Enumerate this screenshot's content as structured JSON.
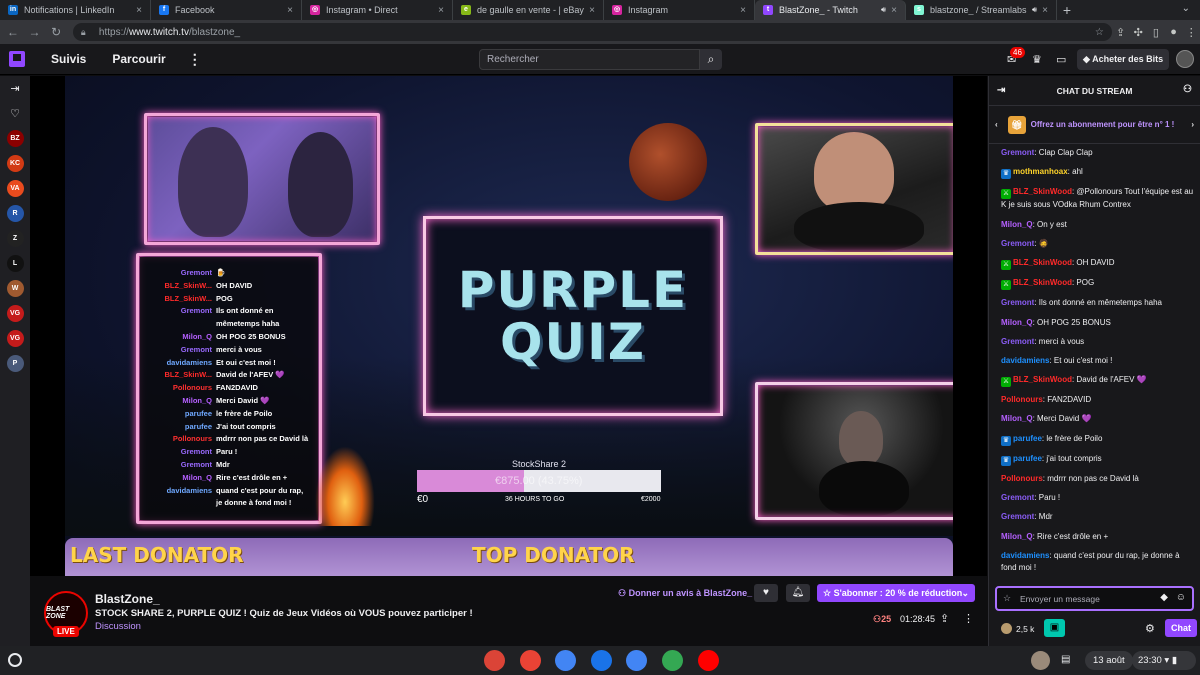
{
  "browser": {
    "tabs": [
      {
        "title": "Notifications | LinkedIn",
        "icon": "in",
        "color": "#0a66c2",
        "active": false,
        "audio": false
      },
      {
        "title": "Facebook",
        "icon": "f",
        "color": "#1877f2",
        "active": false,
        "audio": false
      },
      {
        "title": "Instagram • Direct",
        "icon": "◎",
        "color": "#d6249f",
        "active": false,
        "audio": false
      },
      {
        "title": "de gaulle en vente - | eBay",
        "icon": "e",
        "color": "#86b817",
        "active": false,
        "audio": false
      },
      {
        "title": "Instagram",
        "icon": "◎",
        "color": "#d6249f",
        "active": false,
        "audio": false
      },
      {
        "title": "BlastZone_ - Twitch",
        "icon": "t",
        "color": "#9147ff",
        "active": true,
        "audio": true
      },
      {
        "title": "blastzone_ / Streamlabs",
        "icon": "s",
        "color": "#80f5d2",
        "active": false,
        "audio": true
      }
    ],
    "url_scheme": "https://",
    "url_host": "www.twitch.tv",
    "url_path": "/blastzone_"
  },
  "twitch_nav": {
    "following": "Suivis",
    "browse": "Parcourir",
    "search_placeholder": "Rechercher",
    "notifications_count": "46",
    "get_bits": "Acheter des Bits"
  },
  "sidebar_channels": [
    {
      "initials": "BZ",
      "color": "#8b0000"
    },
    {
      "initials": "KC",
      "color": "#d23a14"
    },
    {
      "initials": "VA",
      "color": "#e94b1e"
    },
    {
      "initials": "R",
      "color": "#2556a8"
    },
    {
      "initials": "Z",
      "color": "#222"
    },
    {
      "initials": "L",
      "color": "#111"
    },
    {
      "initials": "W",
      "color": "#a05a30"
    },
    {
      "initials": "VG",
      "color": "#c41b1b"
    },
    {
      "initials": "VG",
      "color": "#c41b1b"
    },
    {
      "initials": "P",
      "color": "#4a5a7a"
    }
  ],
  "stream": {
    "quiz_line1": "PURPLE",
    "quiz_line2": "QUIZ",
    "goal_title": "StockShare 2",
    "goal_value": "€875.00 (43.75%)",
    "goal_progress": 0.4375,
    "goal_min": "€0",
    "goal_countdown": "36 HOURS TO GO",
    "goal_max": "€2000",
    "last_donator": "LAST DONATOR",
    "top_donator": "TOP DONATOR",
    "overlay_chat": [
      {
        "user": "Gremont",
        "color": "#9a6aff",
        "text": "🍺"
      },
      {
        "user": "BLZ_SkinW...",
        "color": "#ff2a2a",
        "text": "OH DAVID"
      },
      {
        "user": "BLZ_SkinW...",
        "color": "#ff2a2a",
        "text": "POG"
      },
      {
        "user": "Gremont",
        "color": "#9a6aff",
        "text": "Ils ont donné en\nmêmetemps haha"
      },
      {
        "user": "Milon_Q",
        "color": "#b560ff",
        "text": "OH POG 25 BONUS"
      },
      {
        "user": "Gremont",
        "color": "#9a6aff",
        "text": "merci à vous"
      },
      {
        "user": "davidamiens",
        "color": "#6fa8ff",
        "text": "Et oui c'est moi !"
      },
      {
        "user": "BLZ_SkinW...",
        "color": "#ff2a2a",
        "text": "David de l'AFEV 💜"
      },
      {
        "user": "Pollonours",
        "color": "#ff3030",
        "text": "FAN2DAVID"
      },
      {
        "user": "Milon_Q",
        "color": "#b560ff",
        "text": "Merci David 💜"
      },
      {
        "user": "parufee",
        "color": "#6fa8ff",
        "text": "le frère de Poilo"
      },
      {
        "user": "parufee",
        "color": "#6fa8ff",
        "text": "J'ai tout compris"
      },
      {
        "user": "Pollonours",
        "color": "#ff3030",
        "text": "mdrrr non pas ce David là"
      },
      {
        "user": "Gremont",
        "color": "#9a6aff",
        "text": "Paru !"
      },
      {
        "user": "Gremont",
        "color": "#9a6aff",
        "text": "Mdr"
      },
      {
        "user": "Milon_Q",
        "color": "#b560ff",
        "text": "Rire c'est drôle en +"
      },
      {
        "user": "davidamiens",
        "color": "#6fa8ff",
        "text": "quand c'est pour du rap,\nje donne à fond moi !"
      }
    ]
  },
  "channel": {
    "logo_text": "BLAST ZONE",
    "live": "LIVE",
    "name": "BlastZone_",
    "title": "STOCK SHARE 2, PURPLE QUIZ ! Quiz de Jeux Vidéos où VOUS pouvez participer !",
    "category": "Discussion",
    "review": "Donner un avis à BlastZone_",
    "subscribe": "S'abonner : 20 % de réduction",
    "viewers": "25",
    "uptime": "01:28:45"
  },
  "chat": {
    "header": "CHAT DU STREAM",
    "gift_banner": "Offrez un abonnement pour être n° 1 !",
    "messages": [
      {
        "user": "Gremont",
        "color": "#8a5cf5",
        "badge": "",
        "text": "Clap Clap Clap"
      },
      {
        "user": "mothmanhoax",
        "color": "#ffd42a",
        "badge": "sub",
        "text": "ahl"
      },
      {
        "user": "BLZ_SkinWood",
        "color": "#ff2a2a",
        "badge": "mod",
        "text": "@Pollonours Tout l'équipe est au K je suis sous VOdka Rhum Contrex"
      },
      {
        "user": "Milon_Q",
        "color": "#b560ff",
        "badge": "",
        "text": "On y est"
      },
      {
        "user": "Gremont",
        "color": "#8a5cf5",
        "badge": "",
        "text": "🧔"
      },
      {
        "user": "BLZ_SkinWood",
        "color": "#ff2a2a",
        "badge": "mod",
        "text": "OH DAVID"
      },
      {
        "user": "BLZ_SkinWood",
        "color": "#ff2a2a",
        "badge": "mod",
        "text": "POG"
      },
      {
        "user": "Gremont",
        "color": "#8a5cf5",
        "badge": "",
        "text": "Ils ont donné en mêmetemps haha"
      },
      {
        "user": "Milon_Q",
        "color": "#b560ff",
        "badge": "",
        "text": "OH POG 25 BONUS"
      },
      {
        "user": "Gremont",
        "color": "#8a5cf5",
        "badge": "",
        "text": "merci à vous"
      },
      {
        "user": "davidamiens",
        "color": "#1e90ff",
        "badge": "",
        "text": "Et oui c'est moi !"
      },
      {
        "user": "BLZ_SkinWood",
        "color": "#ff2a2a",
        "badge": "mod",
        "text": "David de l'AFEV 💜"
      },
      {
        "user": "Pollonours",
        "color": "#ff2a2a",
        "badge": "",
        "text": "FAN2DAVID"
      },
      {
        "user": "Milon_Q",
        "color": "#b560ff",
        "badge": "",
        "text": "Merci David 💜"
      },
      {
        "user": "parufee",
        "color": "#1e90ff",
        "badge": "sub",
        "text": "le frère de Poilo"
      },
      {
        "user": "parufee",
        "color": "#1e90ff",
        "badge": "sub",
        "text": "j'ai tout compris"
      },
      {
        "user": "Pollonours",
        "color": "#ff2a2a",
        "badge": "",
        "text": "mdrrr non pas ce David là"
      },
      {
        "user": "Gremont",
        "color": "#8a5cf5",
        "badge": "",
        "text": "Paru !"
      },
      {
        "user": "Gremont",
        "color": "#8a5cf5",
        "badge": "",
        "text": "Mdr"
      },
      {
        "user": "Milon_Q",
        "color": "#b560ff",
        "badge": "",
        "text": "Rire c'est drôle en +"
      },
      {
        "user": "davidamiens",
        "color": "#1e90ff",
        "badge": "",
        "text": "quand c'est pour du rap, je donne à fond moi !"
      }
    ],
    "input_placeholder": "Envoyer un message",
    "points": "2,5 k",
    "send_label": "Chat"
  },
  "taskbar": {
    "apps": [
      {
        "name": "chrome",
        "color": "#db4437"
      },
      {
        "name": "gmail",
        "color": "#ea4335"
      },
      {
        "name": "calendar",
        "color": "#4285f4"
      },
      {
        "name": "files",
        "color": "#1a73e8"
      },
      {
        "name": "docs",
        "color": "#4285f4"
      },
      {
        "name": "photos",
        "color": "#34a853"
      },
      {
        "name": "youtube",
        "color": "#ff0000"
      }
    ],
    "date": "13 août",
    "time": "23:30"
  }
}
